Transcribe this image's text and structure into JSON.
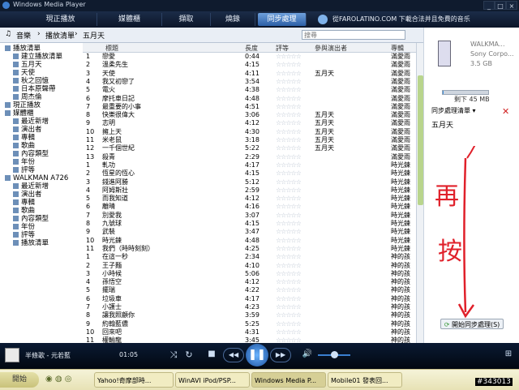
{
  "window": {
    "title": "Windows Media Player"
  },
  "tabs": [
    {
      "label": "現正播放",
      "active": false
    },
    {
      "label": "媒體櫃",
      "active": false
    },
    {
      "label": "擷取",
      "active": false
    },
    {
      "label": "燒錄",
      "active": false
    },
    {
      "label": "同步處理",
      "active": true
    }
  ],
  "promo": "從FAROLATINO.COM 下載合法并且免費的音乐",
  "breadcrumb": [
    "音樂",
    "播放清單",
    "五月天"
  ],
  "search": {
    "placeholder": "搜尋"
  },
  "nav": [
    {
      "label": "播放清單",
      "indent": 0
    },
    {
      "label": "建立播放清單",
      "indent": 1
    },
    {
      "label": "五月天",
      "indent": 1
    },
    {
      "label": "天使",
      "indent": 1
    },
    {
      "label": "秋之回憶",
      "indent": 1
    },
    {
      "label": "日本原聲帶",
      "indent": 1
    },
    {
      "label": "周杰倫",
      "indent": 1
    },
    {
      "label": "現正播放",
      "indent": 0
    },
    {
      "label": "媒體櫃",
      "indent": 0
    },
    {
      "label": "最近新增",
      "indent": 1
    },
    {
      "label": "演出者",
      "indent": 1
    },
    {
      "label": "專輯",
      "indent": 1
    },
    {
      "label": "歌曲",
      "indent": 1
    },
    {
      "label": "內容類型",
      "indent": 1
    },
    {
      "label": "年份",
      "indent": 1
    },
    {
      "label": "評等",
      "indent": 1
    },
    {
      "label": "WALKMAN A726",
      "indent": 0
    },
    {
      "label": "最近新增",
      "indent": 1
    },
    {
      "label": "演出者",
      "indent": 1
    },
    {
      "label": "專輯",
      "indent": 1
    },
    {
      "label": "歌曲",
      "indent": 1
    },
    {
      "label": "內容類型",
      "indent": 1
    },
    {
      "label": "年份",
      "indent": 1
    },
    {
      "label": "評等",
      "indent": 1
    },
    {
      "label": "播放清單",
      "indent": 1
    }
  ],
  "table": {
    "headers": [
      "標題",
      "長度",
      "評等",
      "參與演出者",
      "專輯"
    ],
    "rows": [
      [
        "1",
        "戀愛",
        "0:44",
        "",
        "滿愛雨"
      ],
      [
        "2",
        "溫柔先生",
        "4:15",
        "",
        "滿愛雨"
      ],
      [
        "3",
        "天使",
        "4:11",
        "五月天",
        "滿愛雨"
      ],
      [
        "4",
        "我又初戀了",
        "3:54",
        "",
        "滿愛雨"
      ],
      [
        "5",
        "電火",
        "4:38",
        "",
        "滿愛雨"
      ],
      [
        "6",
        "摩托車日記",
        "4:48",
        "",
        "滿愛雨"
      ],
      [
        "7",
        "最重要的小事",
        "4:51",
        "",
        "滿愛雨"
      ],
      [
        "8",
        "快樂很偉大",
        "3:06",
        "五月天",
        "滿愛雨"
      ],
      [
        "9",
        "志明",
        "4:12",
        "五月天",
        "滿愛雨"
      ],
      [
        "10",
        "擁上天",
        "4:30",
        "五月天",
        "滿愛雨"
      ],
      [
        "11",
        "米老鼠",
        "3:18",
        "五月天",
        "滿愛雨"
      ],
      [
        "12",
        "一千個世紀",
        "5:22",
        "五月天",
        "滿愛雨"
      ],
      [
        "13",
        "殺青",
        "2:29",
        "",
        "滿愛雨"
      ],
      [
        "1",
        "軋功",
        "4:17",
        "",
        "時光鍊"
      ],
      [
        "2",
        "恆星的恆心",
        "4:15",
        "",
        "時光鍊"
      ],
      [
        "3",
        "錢進阿勝",
        "5:12",
        "",
        "時光鍊"
      ],
      [
        "4",
        "阿姆斯壯",
        "2:59",
        "",
        "時光鍊"
      ],
      [
        "5",
        "而我知道",
        "4:12",
        "",
        "時光鍊"
      ],
      [
        "6",
        "離晴",
        "4:16",
        "",
        "時光鍊"
      ],
      [
        "7",
        "別愛我",
        "3:07",
        "",
        "時光鍊"
      ],
      [
        "8",
        "九號球",
        "4:15",
        "",
        "時光鍊"
      ],
      [
        "9",
        "武裝",
        "3:47",
        "",
        "時光鍊"
      ],
      [
        "10",
        "時光鍊",
        "4:48",
        "",
        "時光鍊"
      ],
      [
        "11",
        "我們（時時刻刻）",
        "4:25",
        "",
        "時光鍊"
      ],
      [
        "1",
        "在這一秒",
        "2:34",
        "",
        "神的孩"
      ],
      [
        "2",
        "王子麵",
        "4:10",
        "",
        "神的孩"
      ],
      [
        "3",
        "小時候",
        "5:06",
        "",
        "神的孩"
      ],
      [
        "4",
        "孫悟空",
        "4:12",
        "",
        "神的孩"
      ],
      [
        "5",
        "擺瑞",
        "4:22",
        "",
        "神的孩"
      ],
      [
        "6",
        "垃圾車",
        "4:17",
        "",
        "神的孩"
      ],
      [
        "7",
        "小護士",
        "4:23",
        "",
        "神的孩"
      ],
      [
        "8",
        "讓我照顧你",
        "3:59",
        "",
        "神的孩"
      ],
      [
        "9",
        "約翰藍儂",
        "5:25",
        "",
        "神的孩"
      ],
      [
        "10",
        "回來吧",
        "4:31",
        "",
        "神的孩"
      ],
      [
        "11",
        "權輸龍",
        "3:45",
        "",
        "神的孩"
      ]
    ]
  },
  "sync": {
    "device_name": "WALKMA...",
    "device_maker": "Sony Corpo...",
    "device_capacity": "3.5 GB",
    "free_space": "剩下 45 MB",
    "free_fraction": 0.02,
    "list_title": "同步處理清單 ▾",
    "list_items": [
      "五月天"
    ],
    "start_button": "開始同步處理(S)"
  },
  "annotation": {
    "line1": "再",
    "line2": "按"
  },
  "player": {
    "now_playing": "半條歌 - 元若藍",
    "time": "01:05"
  },
  "taskbar": {
    "start": "開始",
    "tasks": [
      "Yahoo!奇摩部時...",
      "WinAVI iPod/PSP...",
      "Windows Media P...",
      "Mobile01 發表回..."
    ]
  },
  "watermark": "#343013",
  "colors": {
    "accent": "#2c5fa6",
    "annotation_red": "#e0202a",
    "meter": "#3f8fda"
  }
}
